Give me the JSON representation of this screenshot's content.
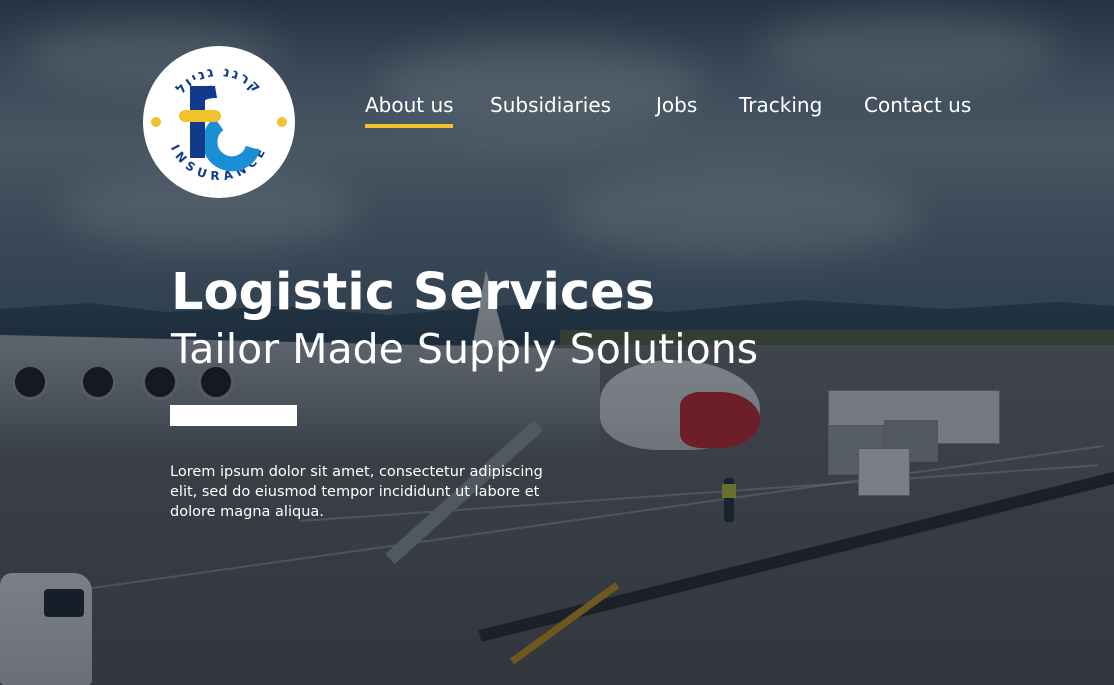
{
  "logo": {
    "brand_letters": "fc",
    "arc_text_top": "קרגנ גניול",
    "arc_text_bottom": "INSURANCE",
    "colors": {
      "navy": "#123a8a",
      "sky": "#1b8fd6",
      "yellow": "#f2c12e"
    }
  },
  "nav": {
    "items": [
      {
        "label": "About us",
        "active": true
      },
      {
        "label": "Subsidiaries",
        "active": false
      },
      {
        "label": "Jobs",
        "active": false
      },
      {
        "label": "Tracking",
        "active": false
      },
      {
        "label": "Contact us",
        "active": false
      }
    ],
    "active_color": "#f2c12e"
  },
  "hero": {
    "title": "Logistic Services",
    "subtitle": "Tailor Made Supply Solutions",
    "body": "Lorem ipsum dolor sit amet, consectetur adipiscing elit, sed do eiusmod tempor incididunt ut labore et dolore magna aliqua.",
    "background": "airport apron with aircraft at jet bridge"
  }
}
